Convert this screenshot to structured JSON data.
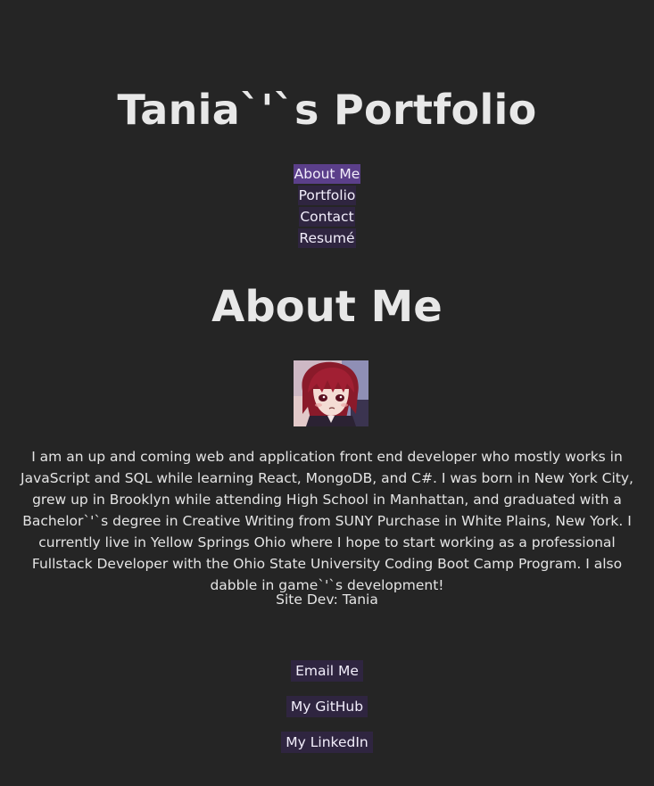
{
  "header": {
    "title": "Tania`'`s Portfolio"
  },
  "nav": {
    "items": [
      {
        "label": "About Me",
        "active": true
      },
      {
        "label": "Portfolio",
        "active": false
      },
      {
        "label": "Contact",
        "active": false
      },
      {
        "label": "Resumé",
        "active": false
      }
    ]
  },
  "main": {
    "section_title": "About Me",
    "avatar_icon": "anime-avatar-image",
    "bio": "I am an up and coming web and application front end developer who mostly works in JavaScript and SQL while learning React, MongoDB, and C#. I was born in New York City, grew up in Brooklyn while attending High School in Manhattan, and graduated with a Bachelor`'`s degree in Creative Writing from SUNY Purchase in White Plains, New York. I currently live in Yellow Springs Ohio where I hope to start working as a professional Fullstack Developer with the Ohio State University Coding Boot Camp Program. I also dabble in game`'`s development!",
    "credit": "Site Dev: Tania"
  },
  "footer": {
    "links": [
      {
        "label": "Email Me"
      },
      {
        "label": "My GitHub"
      },
      {
        "label": "My LinkedIn"
      }
    ]
  },
  "colors": {
    "background": "#252525",
    "text": "#e6e6e6",
    "nav_bg": "#2f2540",
    "nav_active_bg": "#5b3f8a"
  }
}
